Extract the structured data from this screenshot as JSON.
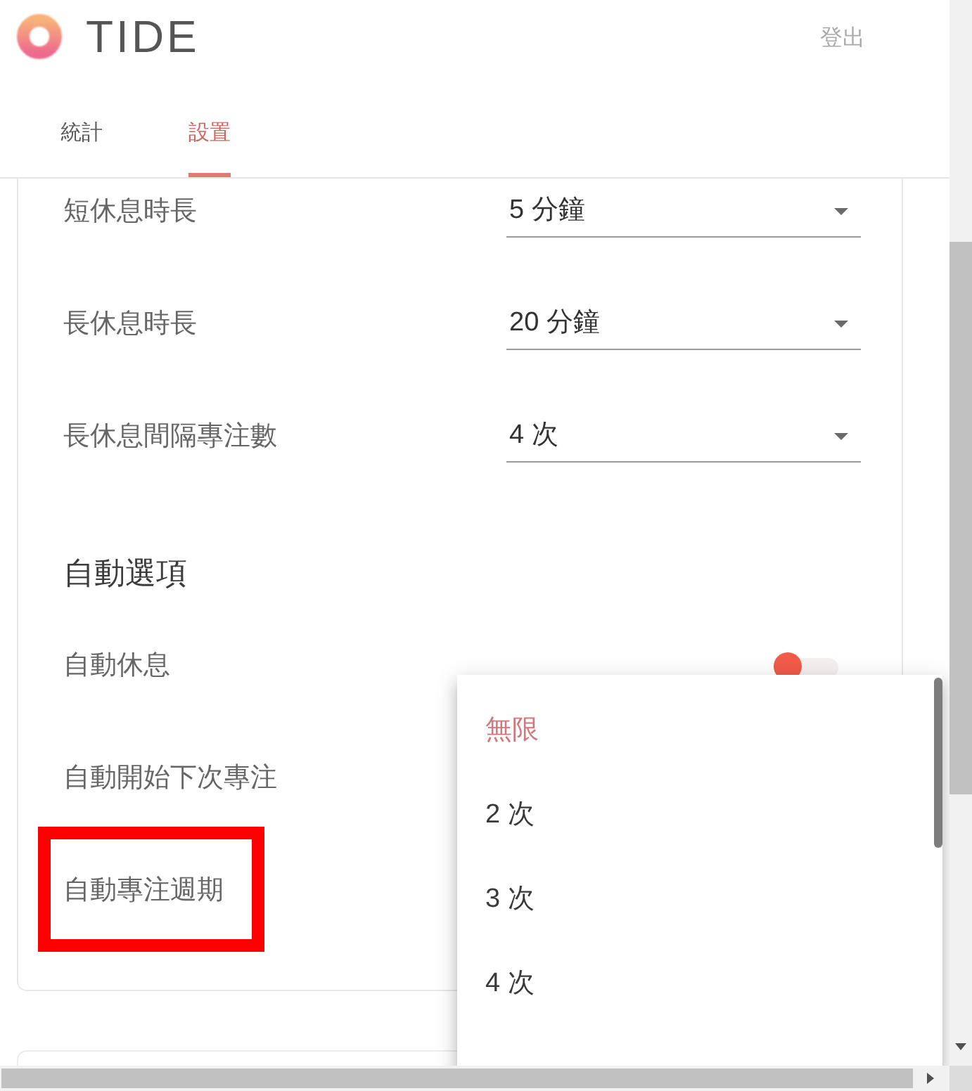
{
  "header": {
    "logo": "TIDE",
    "logout": "登出"
  },
  "tabs": [
    {
      "label": "統計",
      "selected": false
    },
    {
      "label": "設置",
      "selected": true
    }
  ],
  "settings": {
    "durations": [
      {
        "label": "短休息時長",
        "value": "5 分鐘"
      },
      {
        "label": "長休息時長",
        "value": "20 分鐘"
      },
      {
        "label": "長休息間隔專注數",
        "value": "4 次"
      }
    ],
    "auto_section": {
      "title": "自動選項",
      "options": [
        {
          "label": "自動休息",
          "switch": {
            "on": true
          },
          "highlighted": false
        },
        {
          "label": "自動開始下次專注",
          "highlighted": false
        },
        {
          "label": "自動專注週期",
          "highlighted": true
        }
      ]
    }
  },
  "dropdown_menu": {
    "options": [
      {
        "label": "無限",
        "selected": true
      },
      {
        "label": "2 次",
        "selected": false
      },
      {
        "label": "3 次",
        "selected": false
      },
      {
        "label": "4 次",
        "selected": false
      }
    ]
  }
}
